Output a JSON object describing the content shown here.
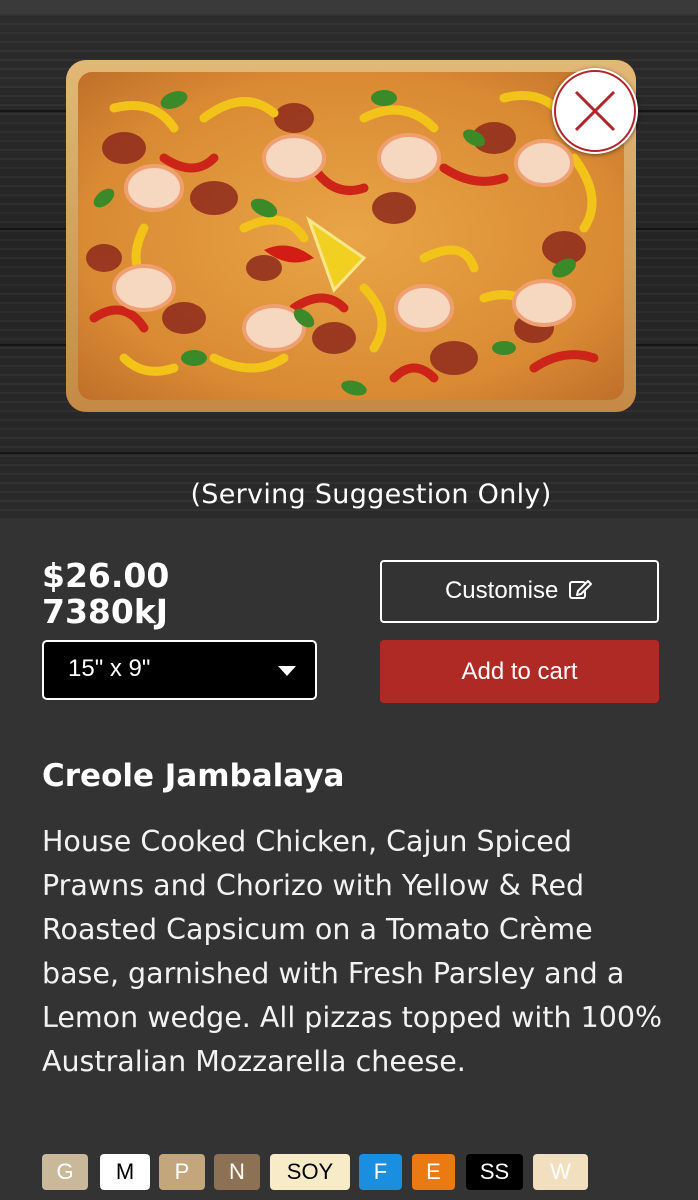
{
  "hero": {
    "image_caption": "(Serving Suggestion Only)",
    "close_icon": "close-icon"
  },
  "product": {
    "price": "$26.00",
    "energy": "7380kJ",
    "size_selected": "15\" x 9\"",
    "customise_label": "Customise",
    "customise_icon": "edit-icon",
    "add_to_cart_label": "Add to cart",
    "name": "Creole Jambalaya",
    "description": "House Cooked Chicken, Cajun Spiced Prawns and Chorizo with Yellow & Red Roasted Capsicum on a Tomato Crème base, garnished with Fresh Parsley and a Lemon wedge. All pizzas topped with 100% Australian Mozzarella cheese."
  },
  "allergens": [
    {
      "label": "G",
      "bg": "#c9b99a",
      "fg": "#ffffff"
    },
    {
      "label": "M",
      "bg": "#ffffff",
      "fg": "#000000"
    },
    {
      "label": "P",
      "bg": "#c4a67c",
      "fg": "#ffffff"
    },
    {
      "label": "N",
      "bg": "#8c7154",
      "fg": "#ffffff"
    },
    {
      "label": "SOY",
      "bg": "#f7ecc7",
      "fg": "#000000"
    },
    {
      "label": "F",
      "bg": "#1a8fe0",
      "fg": "#ffffff"
    },
    {
      "label": "E",
      "bg": "#ec7a12",
      "fg": "#ffffff"
    },
    {
      "label": "SS",
      "bg": "#000000",
      "fg": "#ffffff"
    },
    {
      "label": "W",
      "bg": "#f2dfbf",
      "fg": "#ffffff"
    }
  ],
  "colors": {
    "background": "#333333",
    "add_to_cart": "#b02a25",
    "close_x": "#b0262b"
  }
}
